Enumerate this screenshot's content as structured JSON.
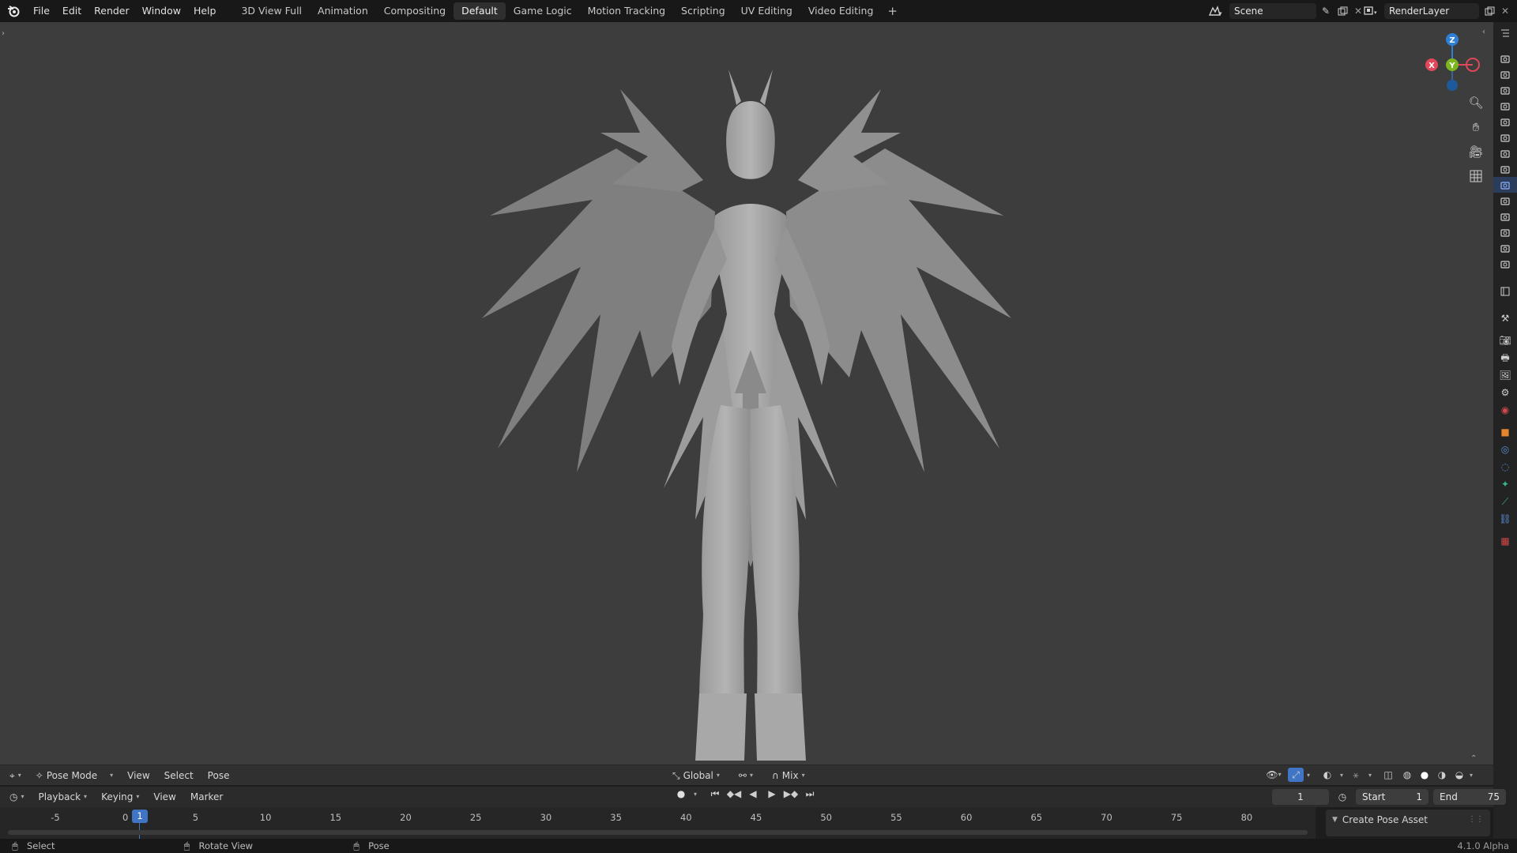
{
  "menu": [
    "File",
    "Edit",
    "Render",
    "Window",
    "Help"
  ],
  "workspaces": [
    {
      "label": "3D View Full",
      "active": false
    },
    {
      "label": "Animation",
      "active": false
    },
    {
      "label": "Compositing",
      "active": false
    },
    {
      "label": "Default",
      "active": true
    },
    {
      "label": "Game Logic",
      "active": false
    },
    {
      "label": "Motion Tracking",
      "active": false
    },
    {
      "label": "Scripting",
      "active": false
    },
    {
      "label": "UV Editing",
      "active": false
    },
    {
      "label": "Video Editing",
      "active": false
    }
  ],
  "workspace_add": "+",
  "scene": {
    "name": "Scene"
  },
  "render_layer": {
    "name": "RenderLayer"
  },
  "gizmo": {
    "x": "X",
    "y": "Y",
    "z": "Z"
  },
  "viewport_header": {
    "mode": "Pose Mode",
    "menus": [
      "View",
      "Select",
      "Pose"
    ],
    "orientation": "Global",
    "blend": "Mix"
  },
  "timeline_header": {
    "menus": [
      "Playback",
      "Keying",
      "View",
      "Marker"
    ],
    "current_frame": "1",
    "start_label": "Start",
    "start_value": "1",
    "end_label": "End",
    "end_value": "75"
  },
  "timeline": {
    "ticks": [
      "-5",
      "0",
      "5",
      "10",
      "15",
      "20",
      "25",
      "30",
      "35",
      "40",
      "45",
      "50",
      "55",
      "60",
      "65",
      "70",
      "75",
      "80"
    ],
    "playhead": "1"
  },
  "pose_panel": {
    "label": "Create Pose Asset"
  },
  "statusbar": {
    "select": "Select",
    "rotate": "Rotate View",
    "pose": "Pose",
    "version": "4.1.0 Alpha"
  },
  "colors": {
    "viewport": "#3d3d3d",
    "accent": "#3f75c4",
    "axis_x": "#e0485a",
    "axis_y": "#7db51f",
    "axis_z": "#2f7fd6"
  }
}
